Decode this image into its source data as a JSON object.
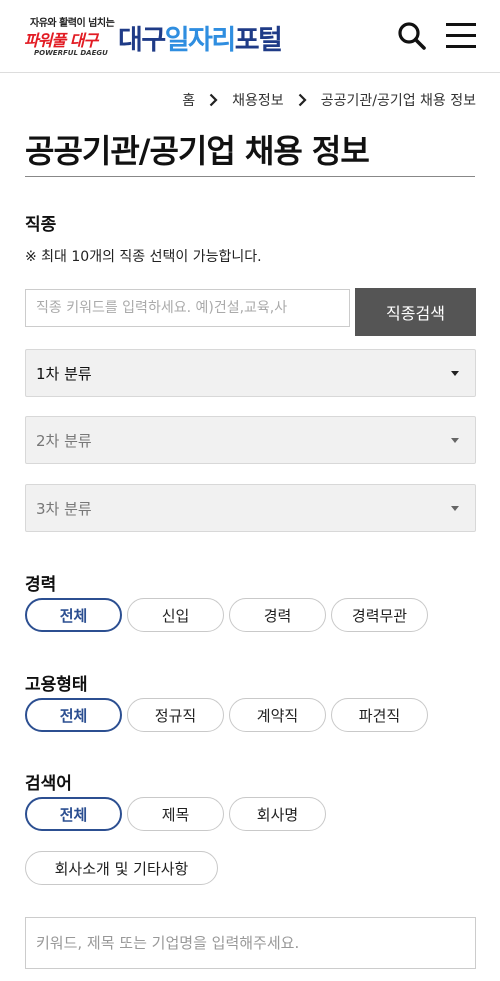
{
  "header": {
    "logo_slogan": "자유와 활력이 넘치는",
    "logo_power": "파워풀 대구",
    "logo_english": "POWERFUL DAEGU",
    "logo_part1": "대구",
    "logo_part2": "일자리",
    "logo_part3": "포털"
  },
  "breadcrumb": [
    "홈",
    "채용정보",
    "공공기관/공기업 채용 정보"
  ],
  "page_title": "공공기관/공기업 채용 정보",
  "job_type": {
    "label": "직종",
    "note": "※ 최대 10개의 직종 선택이 가능합니다.",
    "keyword_placeholder": "직종 키워드를 입력하세요. 예)건설,교육,사",
    "search_button": "직종검색",
    "selects": [
      "1차 분류",
      "2차 분류",
      "3차 분류"
    ]
  },
  "career": {
    "label": "경력",
    "options": [
      "전체",
      "신입",
      "경력",
      "경력무관"
    ],
    "selected": "전체"
  },
  "employment_type": {
    "label": "고용형태",
    "options": [
      "전체",
      "정규직",
      "계약직",
      "파견직"
    ],
    "selected": "전체"
  },
  "search_target": {
    "label": "검색어",
    "options": [
      "전체",
      "제목",
      "회사명",
      "회사소개 및 기타사항"
    ],
    "selected": "전체",
    "input_placeholder": "키워드, 제목 또는 기업명을 입력해주세요."
  },
  "colors": {
    "brand_navy": "#1f3b87",
    "brand_blue": "#2f8ee0",
    "brand_red": "#e21b23",
    "active_pill": "#2c4f91",
    "search_button_bg": "#555555"
  }
}
